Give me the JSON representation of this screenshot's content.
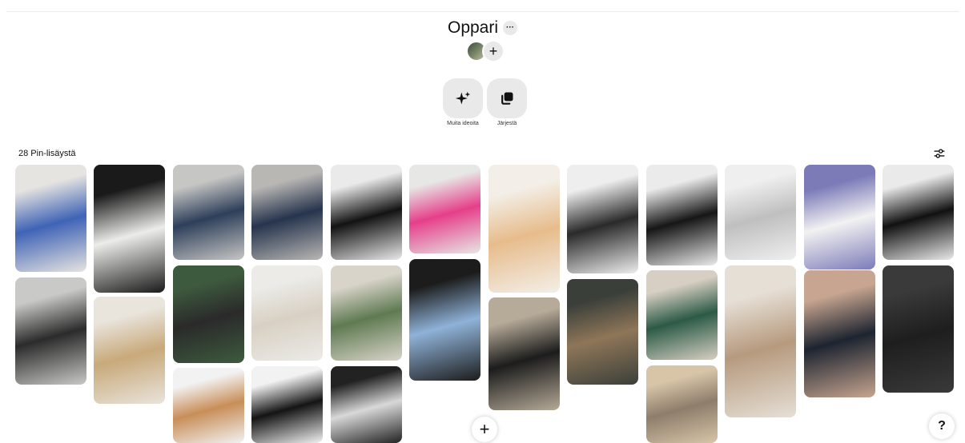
{
  "board": {
    "title": "Oppari",
    "pin_count_label": "28 Pin-lisäystä"
  },
  "actions": {
    "more_ideas_label": "Muita ideoita",
    "organize_label": "Järjestä"
  },
  "icons": {
    "more": "more-horizontal-icon",
    "add_collaborator": "plus-icon",
    "more_ideas": "sparkle-icon",
    "organize": "organize-icon",
    "filter": "filter-sliders-icon",
    "create": "plus-icon",
    "help": "question-mark-icon"
  },
  "floating": {
    "help_label": "?"
  },
  "pins": [
    {
      "colors": [
        "#3f63b6",
        "#e6e4e0"
      ]
    },
    {
      "colors": [
        "#2b2b2b",
        "#c9c9c7"
      ]
    },
    {
      "colors": [
        "#ececea",
        "#1a1a1a"
      ]
    },
    {
      "colors": [
        "#c8a97a",
        "#e9e4dc"
      ]
    },
    {
      "colors": [
        "#2e3f5a",
        "#c6c6c4"
      ]
    },
    {
      "colors": [
        "#2a2a2a",
        "#3e5a3e"
      ]
    },
    {
      "colors": [
        "#c88e58",
        "#f2f2f2"
      ]
    },
    {
      "colors": [
        "#26344d",
        "#b9b7b4"
      ]
    },
    {
      "colors": [
        "#d8d0c3",
        "#ecebe8"
      ]
    },
    {
      "colors": [
        "#141414",
        "#f2f2f2"
      ]
    },
    {
      "colors": [
        "#131313",
        "#eaeaea"
      ]
    },
    {
      "colors": [
        "#5f7a52",
        "#d9d4ca"
      ]
    },
    {
      "colors": [
        "#d8d8d8",
        "#222222"
      ]
    },
    {
      "colors": [
        "#e63f8a",
        "#e7e7e5"
      ]
    },
    {
      "colors": [
        "#8fb2d8",
        "#1c1c1c"
      ]
    },
    {
      "colors": [
        "#e7bc8c",
        "#f3efe8"
      ]
    },
    {
      "colors": [
        "#1c1c1c",
        "#b6aa98"
      ]
    },
    {
      "colors": [
        "#2a2a2a",
        "#eeeeee"
      ]
    },
    {
      "colors": [
        "#8e7658",
        "#3b3f3a"
      ]
    },
    {
      "colors": [
        "#161616",
        "#ebebeb"
      ]
    },
    {
      "colors": [
        "#2c5a46",
        "#d7cfc3"
      ]
    },
    {
      "colors": [
        "#8d7d6b",
        "#d8c5a8"
      ]
    },
    {
      "colors": [
        "#bfbfbf",
        "#efefef"
      ]
    },
    {
      "colors": [
        "#b69a7e",
        "#e6dfd6"
      ]
    },
    {
      "colors": [
        "#f2f2f2",
        "#7c7bb8"
      ]
    },
    {
      "colors": [
        "#1d2430",
        "#c7a590"
      ]
    },
    {
      "colors": [
        "#111111",
        "#eaeaea"
      ]
    },
    {
      "colors": [
        "#1e1e1e",
        "#3a3a3a"
      ]
    }
  ]
}
